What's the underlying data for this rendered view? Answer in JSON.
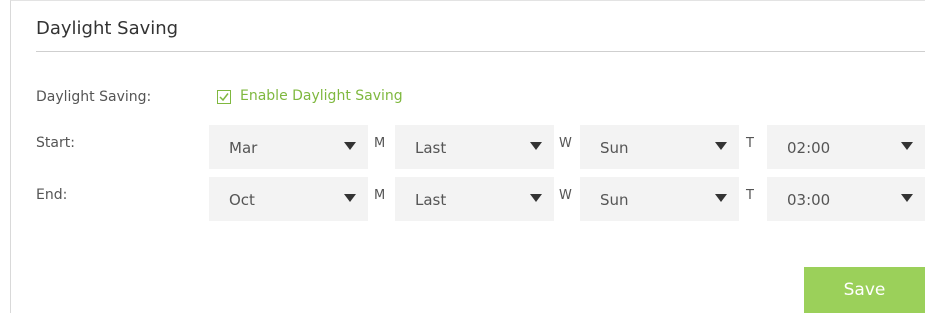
{
  "section": {
    "title": "Daylight Saving"
  },
  "daylight_saving": {
    "label": "Daylight Saving:",
    "checkbox_label": "Enable Daylight Saving",
    "checked": true,
    "accent_color": "#7fb83f"
  },
  "start": {
    "label": "Start:",
    "month": "Mar",
    "week": "Last",
    "day": "Sun",
    "time": "02:00"
  },
  "end": {
    "label": "End:",
    "month": "Oct",
    "week": "Last",
    "day": "Sun",
    "time": "03:00"
  },
  "separators": {
    "month": "M",
    "week": "W",
    "time": "T"
  },
  "actions": {
    "save_label": "Save",
    "save_color": "#9bd05a"
  },
  "icons": {
    "checkbox": "checkbox-checked-icon",
    "dropdown": "triangle-down-icon"
  }
}
